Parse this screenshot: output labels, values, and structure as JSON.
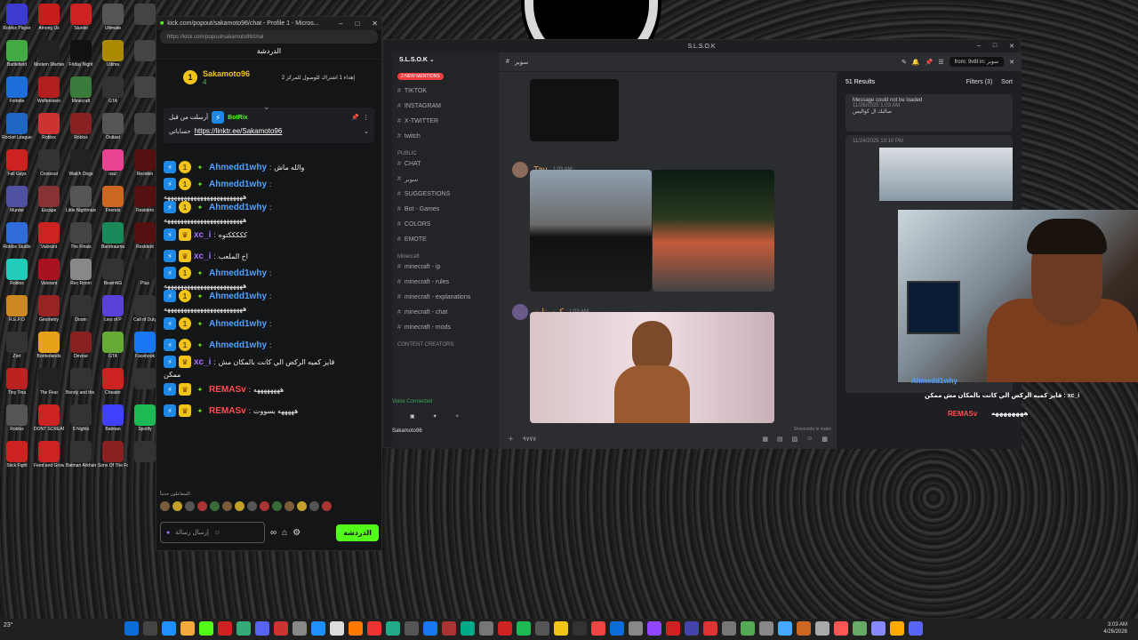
{
  "desktop": {
    "icons": [
      {
        "label": "Roblox Player",
        "color": "#3b3bd0"
      },
      {
        "label": "Among Us",
        "color": "#c81d1d"
      },
      {
        "label": "Stuntin",
        "color": "#c22"
      },
      {
        "label": "Ultimate",
        "color": "#555"
      },
      {
        "label": "",
        "color": "#444"
      },
      {
        "label": "Battlefield",
        "color": "#4a4"
      },
      {
        "label": "Modern Warfare",
        "color": "#222"
      },
      {
        "label": "Friday Night",
        "color": "#111"
      },
      {
        "label": "Ultima",
        "color": "#aa8b00"
      },
      {
        "label": "",
        "color": "#444"
      },
      {
        "label": "Fortnite",
        "color": "#1e6fd9"
      },
      {
        "label": "Wolfenstein",
        "color": "#b31e1e"
      },
      {
        "label": "Minecraft",
        "color": "#3a7a3a"
      },
      {
        "label": "GTA",
        "color": "#333"
      },
      {
        "label": "",
        "color": "#444"
      },
      {
        "label": "Rocket League",
        "color": "#1f66c2"
      },
      {
        "label": "Roblox",
        "color": "#c33"
      },
      {
        "label": "Roblox",
        "color": "#822"
      },
      {
        "label": "Outlast",
        "color": "#555"
      },
      {
        "label": "",
        "color": "#444"
      },
      {
        "label": "Fall Guys",
        "color": "#c22"
      },
      {
        "label": "Crossout",
        "color": "#333"
      },
      {
        "label": "Watch Dogs",
        "color": "#222"
      },
      {
        "label": "osu!",
        "color": "#e84393"
      },
      {
        "label": "Residen",
        "color": "#511"
      },
      {
        "label": "Murder",
        "color": "#5050a0"
      },
      {
        "label": "Escape",
        "color": "#833"
      },
      {
        "label": "Little Nightmares",
        "color": "#555"
      },
      {
        "label": "Friends",
        "color": "#c62"
      },
      {
        "label": "Resident",
        "color": "#511"
      },
      {
        "label": "Roblox Studio",
        "color": "#2f6bd9"
      },
      {
        "label": "Valorant",
        "color": "#c22"
      },
      {
        "label": "The Finals",
        "color": "#444"
      },
      {
        "label": "Barotrauma",
        "color": "#1a8a5a"
      },
      {
        "label": "Resident",
        "color": "#511"
      },
      {
        "label": "Roblox",
        "color": "#2cb"
      },
      {
        "label": "Valorant",
        "color": "#a12"
      },
      {
        "label": "Rec Room",
        "color": "#888"
      },
      {
        "label": "BeamNG",
        "color": "#333"
      },
      {
        "label": "Plus",
        "color": "#222"
      },
      {
        "label": "R.E.P.O",
        "color": "#c82"
      },
      {
        "label": "Geometry",
        "color": "#922"
      },
      {
        "label": "Doom",
        "color": "#333"
      },
      {
        "label": "Lies of P",
        "color": "#5a3fd9"
      },
      {
        "label": "Call of Duty",
        "color": "#333"
      },
      {
        "label": "Zort",
        "color": "#333"
      },
      {
        "label": "Borderlands",
        "color": "#e8a21a"
      },
      {
        "label": "Devour",
        "color": "#822"
      },
      {
        "label": "GTA",
        "color": "#6a3"
      },
      {
        "label": "Facebook",
        "color": "#1877f2"
      },
      {
        "label": "Tiny Tina",
        "color": "#b22"
      },
      {
        "label": "The Fear",
        "color": "#222"
      },
      {
        "label": "Bendy and the Ink",
        "color": "#333"
      },
      {
        "label": "Cheater",
        "color": "#c22"
      },
      {
        "label": "",
        "color": "#333"
      },
      {
        "label": "Roblox",
        "color": "#555"
      },
      {
        "label": "DONT SCREAM",
        "color": "#c22"
      },
      {
        "label": "5 Nights",
        "color": "#333"
      },
      {
        "label": "Batman",
        "color": "#4040ff"
      },
      {
        "label": "Spotify",
        "color": "#1db954"
      },
      {
        "label": "Stick Fight",
        "color": "#c22"
      },
      {
        "label": "Feed and Grow",
        "color": "#c22"
      },
      {
        "label": "Batman Arkham",
        "color": "#333"
      },
      {
        "label": "Sons Of The Forest",
        "color": "#822"
      },
      {
        "label": "",
        "color": "#333"
      }
    ]
  },
  "kick": {
    "window_title": "kick.com/popout/sakamoto96/chat - Profile 1 - Micros...",
    "url": "https://kick.com/popout/sakamoto96/chat",
    "header": "الدردشة",
    "channel_name": "Sakamoto96",
    "channel_count": "4",
    "gift_text": "إهداء 1 اشتراك للوصول للمركز 2",
    "pinned_by": "أرسلت من قبل",
    "pinned_user": "BotRix",
    "pinned_prefix": "حساباتي",
    "pinned_link": "https://linktr.ee/Sakamoto96",
    "messages": [
      {
        "user": "Ahmedd1why",
        "user_color": "#4fa3ff",
        "text": "والله ماش",
        "badge": "star"
      },
      {
        "user": "Ahmedd1why",
        "user_color": "#4fa3ff",
        "text": "",
        "wide": "ههههههههههههههههههههههههه",
        "badge": "star"
      },
      {
        "user": "Ahmedd1why",
        "user_color": "#4fa3ff",
        "text": "",
        "wide": "ههههههههههههههههههههههههه",
        "badge": "star"
      },
      {
        "user": "xc_i",
        "user_color": "#a970ff",
        "text": "كككككتوه",
        "badge": "crown"
      },
      {
        "user": "xc_i",
        "user_color": "#a970ff",
        "text": "اخ الملعب",
        "badge": "crown"
      },
      {
        "user": "Ahmedd1why",
        "user_color": "#4fa3ff",
        "text": "",
        "wide": "ههههههههههههههههههههههههه",
        "badge": "star"
      },
      {
        "user": "Ahmedd1why",
        "user_color": "#4fa3ff",
        "text": "",
        "wide": "ههههههههههههههههههههههههه",
        "badge": "star"
      },
      {
        "user": "Ahmedd1why",
        "user_color": "#4fa3ff",
        "text": "",
        "badge": "star"
      },
      {
        "user": "Ahmedd1why",
        "user_color": "#4fa3ff",
        "text": "",
        "badge": "star"
      },
      {
        "user": "xc_i",
        "user_color": "#a970ff",
        "text": "قايز كميه الركض الي كانت بالمكان مش",
        "wide": "ممكن",
        "badge": "crown"
      },
      {
        "user": "REMASv",
        "user_color": "#ff4d4d",
        "text": "ههههههههه",
        "badge": "crown"
      },
      {
        "user": "REMASv",
        "user_color": "#ff4d4d",
        "text": "هههههه بسووت",
        "badge": "crown"
      }
    ],
    "reactions_label": "المتفاعلون حديثاً",
    "input_placeholder": "إرسال رسالة",
    "send_label": "الدردشة"
  },
  "discord": {
    "window_title": "S.L.S.O.K",
    "server_name": "S.L.S.O.K",
    "mentions": "2 NEW MENTIONS",
    "channels_top": [
      "TIKTOK",
      "INSTAGRAM",
      "X-TWITTER",
      "twitch"
    ],
    "public_label": "PUBLIC",
    "channels_public": [
      "CHAT",
      "سوبر",
      "SUGGESTIONS",
      "Bot - Games",
      "COLORS",
      "EMOTE"
    ],
    "minecraft_label": "Minecraft",
    "channels_minecraft": [
      "minecraft - ip",
      "minecraft - rules",
      "minecraft - explanations",
      "minecraft - chat",
      "minecraft - mods"
    ],
    "creators_label": "CONTENT CREATORS",
    "voice_status": "Voice Connected",
    "voice_user": "Sakamoto96",
    "current_channel": "سوبر",
    "msg1_user": "Tay",
    "msg1_time": "1:03 AM",
    "msg2_user": "كيمونات",
    "msg2_time": "1:03 AM",
    "slowmode": "Slowmode in make",
    "input_text": "٩٧٧٧",
    "search_from": "from: 9v8t",
    "search_in": "in: سوبر",
    "results": "51 Results",
    "filters": "Filters (3)",
    "sort": "Sort",
    "result1_text": "Message could not be loaded",
    "result1_date": "11/26/2025 1:03 AM",
    "result1_msg": "صالبك ال كواليس",
    "result2_date": "11/24/2025 10:10 PM"
  },
  "overlay": {
    "line1_user": "Ahmedd1why",
    "line2": "قايز كميه الركض الي كانت بالمكان مش ممكن : xc_i",
    "line3_user": "REMASv",
    "line3_text": "ههههههههه"
  },
  "taskbar": {
    "temp": "23°",
    "time": "3:03 AM",
    "date": "4/26/2026"
  }
}
